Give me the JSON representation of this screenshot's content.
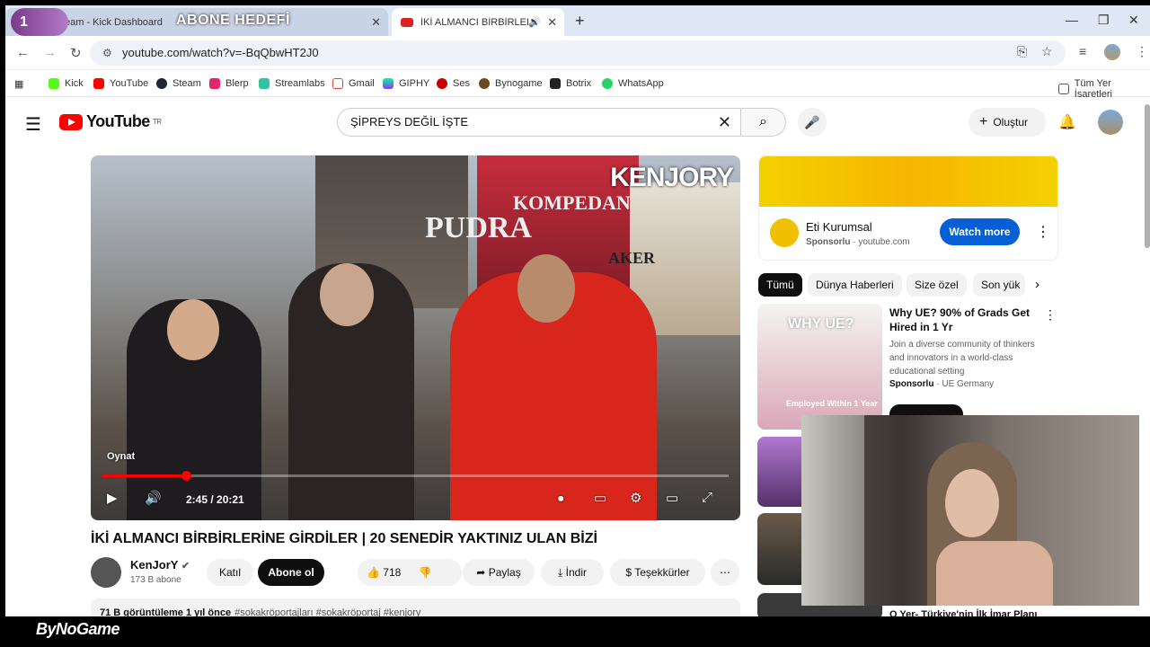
{
  "overlay": {
    "badge": "1",
    "goal_title": "ABONE HEDEFİ"
  },
  "tabs": [
    {
      "label": "eam - Kick Dashboard"
    },
    {
      "label": "İKİ ALMANCI BİRBİRLERİNE"
    }
  ],
  "address": {
    "url": "youtube.com/watch?v=-BqQbwHT2J0"
  },
  "bookmarks": [
    "Kick",
    "YouTube",
    "Steam",
    "Blerp",
    "Streamlabs",
    "Gmail",
    "GIPHY",
    "Ses",
    "Bynogame",
    "Botrix",
    "WhatsApp"
  ],
  "bookmarks_all": "Tüm Yer İşaretleri",
  "yt": {
    "region": "TR",
    "search_query": "ŞİPREYS DEĞİL İŞTE",
    "create_label": "Oluştur"
  },
  "player": {
    "oynat": "Oynat",
    "time": "2:45 / 20:21",
    "progress": 0.135,
    "watermark": "KENJORY"
  },
  "video": {
    "title": "İKİ ALMANCI BİRBİRLERİNE GİRDİLER | 20 SENEDİR YAKTINIZ ULAN BİZİ",
    "channel": "KenJorY",
    "subs": "173 B abone",
    "join": "Katıl",
    "subscribe": "Abone ol",
    "likes": "718",
    "share": "Paylaş",
    "download": "İndir",
    "thanks": "Teşekkürler",
    "views": "71 B görüntüleme  1 yıl önce",
    "tags": "#sokakröportajları #sokakröportaj #kenjory"
  },
  "ad": {
    "name": "Eti Kurumsal",
    "sponsored": "Sponsorlu",
    "domain": "youtube.com",
    "button": "Watch more"
  },
  "chips": [
    "Tümü",
    "Dünya Haberleri",
    "Size özel",
    "Son yük"
  ],
  "rec": {
    "title": "Why UE? 90% of Grads Get Hired in 1 Yr",
    "desc": "Join a diverse community of thinkers and innovators in a world-class educational setting",
    "sponsored": "Sponsorlu",
    "channel": "UE Germany",
    "thumb_text": "WHY UE?",
    "thumb_caption": "Employed Within 1 Year",
    "bottom_title": "O Yer- Türkiye'nin İlk İmar Planı"
  },
  "footer": {
    "brand": "ByNoGame"
  }
}
